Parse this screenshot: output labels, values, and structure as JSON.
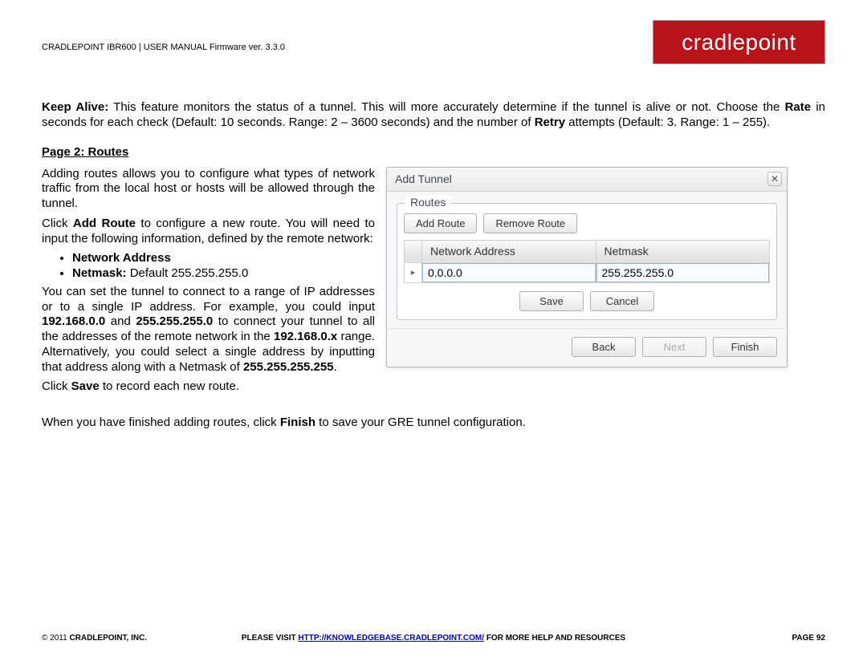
{
  "header": {
    "doc_title": "CRADLEPOINT IBR600 | USER MANUAL Firmware ver. 3.3.0",
    "brand": "cradlepoint"
  },
  "intro": {
    "keep_alive_label": "Keep Alive:",
    "keep_alive_text": " This feature monitors the status of a tunnel. This will more accurately determine if the tunnel is alive or not. Choose the ",
    "rate_label": "Rate",
    "rate_text": " in seconds for each check (Default: 10 seconds. Range: 2 – 3600 seconds) and the number of ",
    "retry_label": "Retry",
    "retry_text": " attempts (Default: 3. Range: 1 – 255)."
  },
  "section_title": "Page 2: Routes",
  "left": {
    "p1": "Adding routes allows you to configure what types of network traffic from the local host or hosts will be allowed through the tunnel.",
    "p2a": "Click ",
    "p2b": "Add Route",
    "p2c": " to configure a new route. You will need to input the following information, defined by the remote network:",
    "bullet1": "Network Address",
    "bullet2a": "Netmask:",
    "bullet2b": " Default 255.255.255.0",
    "p3a": "You can set the tunnel to connect to a range of IP addresses or to a single IP address. For example, you could input ",
    "p3b": "192.168.0.0",
    "p3c": " and ",
    "p3d": "255.255.255.0",
    "p3e": " to connect your tunnel to all the addresses of the remote network in the ",
    "p3f": "192.168.0.x",
    "p3g": " range. Alternatively, you could select a single address by inputting that address along with a Netmask of ",
    "p3h": "255.255.255.255",
    "p3i": ".",
    "p4a": "Click ",
    "p4b": "Save",
    "p4c": " to record each new route."
  },
  "dialog": {
    "title": "Add Tunnel",
    "close_glyph": "✕",
    "legend": "Routes",
    "add_route": "Add Route",
    "remove_route": "Remove Route",
    "col_network": "Network Address",
    "col_netmask": "Netmask",
    "row": {
      "indicator": "▸",
      "network_value": "0.0.0.0",
      "netmask_value": "255.255.255.0"
    },
    "save": "Save",
    "cancel": "Cancel",
    "back": "Back",
    "next": "Next",
    "finish": "Finish"
  },
  "after": {
    "a": "When you have finished adding routes, click ",
    "b": "Finish",
    "c": " to save your GRE tunnel configuration."
  },
  "footer": {
    "left": "© 2011 ",
    "left_bold": "CRADLEPOINT, INC.",
    "center_a": "PLEASE VISIT ",
    "center_link": "HTTP://KNOWLEDGEBASE.CRADLEPOINT.COM/",
    "center_b": " FOR MORE HELP AND RESOURCES",
    "page": "PAGE 92"
  }
}
